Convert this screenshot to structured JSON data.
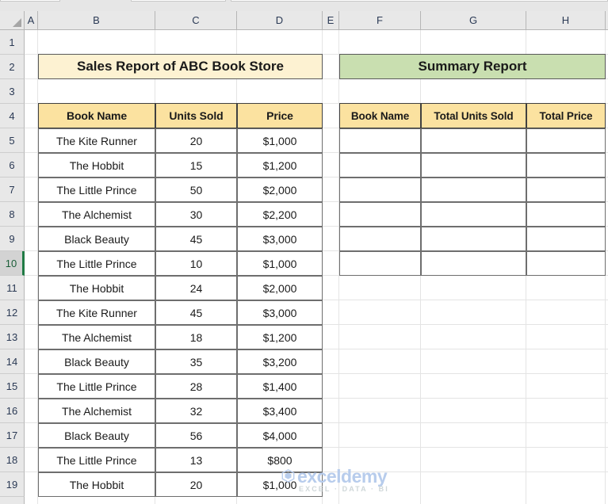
{
  "app": {
    "type": "spreadsheet",
    "column_headers": [
      "A",
      "B",
      "C",
      "D",
      "E",
      "F",
      "G",
      "H"
    ],
    "row_headers": [
      "1",
      "2",
      "3",
      "4",
      "5",
      "6",
      "7",
      "8",
      "9",
      "10",
      "11",
      "12",
      "13",
      "14",
      "15",
      "16",
      "17",
      "18",
      "19"
    ],
    "active_row": "10"
  },
  "colors": {
    "sales_title_fill": "#fdf2d2",
    "summary_title_fill": "#c9dfb0",
    "table_header_fill": "#fbe2a0",
    "cell_fill": "#ffffff",
    "header_band": "#e8e8e8",
    "active_row_accent": "#1f7a44",
    "watermark_text": "#b7ccec"
  },
  "sales_report": {
    "title": "Sales Report of ABC Book Store",
    "columns": [
      "Book Name",
      "Units Sold",
      "Price"
    ],
    "rows": [
      {
        "book": "The Kite Runner",
        "units": "20",
        "price": "$1,000"
      },
      {
        "book": "The Hobbit",
        "units": "15",
        "price": "$1,200"
      },
      {
        "book": "The Little Prince",
        "units": "50",
        "price": "$2,000"
      },
      {
        "book": "The Alchemist",
        "units": "30",
        "price": "$2,200"
      },
      {
        "book": "Black Beauty",
        "units": "45",
        "price": "$3,000"
      },
      {
        "book": "The Little Prince",
        "units": "10",
        "price": "$1,000"
      },
      {
        "book": "The Hobbit",
        "units": "24",
        "price": "$2,000"
      },
      {
        "book": "The Kite Runner",
        "units": "45",
        "price": "$3,000"
      },
      {
        "book": "The Alchemist",
        "units": "18",
        "price": "$1,200"
      },
      {
        "book": "Black Beauty",
        "units": "35",
        "price": "$3,200"
      },
      {
        "book": "The Little Prince",
        "units": "28",
        "price": "$1,400"
      },
      {
        "book": "The Alchemist",
        "units": "32",
        "price": "$3,400"
      },
      {
        "book": "Black Beauty",
        "units": "56",
        "price": "$4,000"
      },
      {
        "book": "The Little Prince",
        "units": "13",
        "price": "$800"
      },
      {
        "book": "The Hobbit",
        "units": "20",
        "price": "$1,000"
      }
    ]
  },
  "summary_report": {
    "title": "Summary Report",
    "columns": [
      "Book Name",
      "Total Units Sold",
      "Total Price"
    ],
    "rows": [
      {
        "book": "",
        "units": "",
        "price": ""
      },
      {
        "book": "",
        "units": "",
        "price": ""
      },
      {
        "book": "",
        "units": "",
        "price": ""
      },
      {
        "book": "",
        "units": "",
        "price": ""
      },
      {
        "book": "",
        "units": "",
        "price": ""
      },
      {
        "book": "",
        "units": "",
        "price": ""
      }
    ]
  },
  "watermark": {
    "word": "exceldemy",
    "tagline": "EXCEL · DATA · BI"
  }
}
